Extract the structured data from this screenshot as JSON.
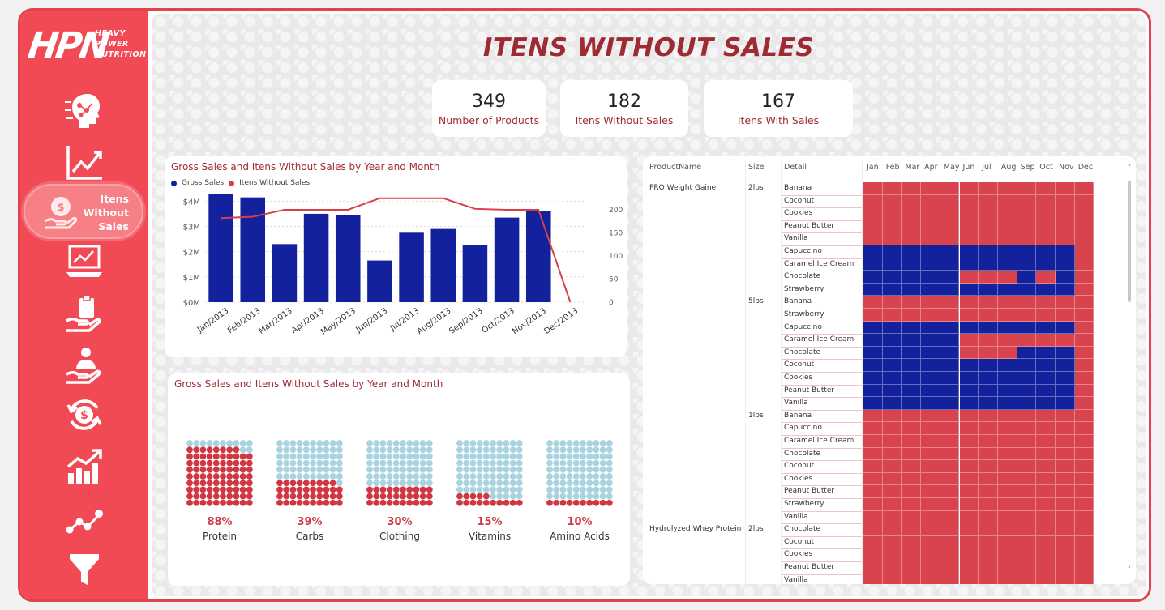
{
  "brand": {
    "logo_text": "HPN",
    "logo_sub": [
      "HEAVY",
      "POWER",
      "NUTRITION"
    ]
  },
  "sidebar": {
    "items": [
      {
        "icon": "ai-head-icon",
        "label": ""
      },
      {
        "icon": "trend-chart-icon",
        "label": ""
      },
      {
        "icon": "money-hand-icon",
        "label": "Itens\nWithout\nSales",
        "active": true
      },
      {
        "icon": "laptop-chart-icon",
        "label": ""
      },
      {
        "icon": "hand-clipboard-icon",
        "label": ""
      },
      {
        "icon": "hand-person-icon",
        "label": ""
      },
      {
        "icon": "dollar-cycle-icon",
        "label": ""
      },
      {
        "icon": "growth-bars-icon",
        "label": ""
      },
      {
        "icon": "line-points-icon",
        "label": ""
      },
      {
        "icon": "funnel-icon",
        "label": ""
      }
    ],
    "active_label_lines": [
      "Itens",
      "Without",
      "Sales"
    ]
  },
  "page": {
    "title": "ITENS WITHOUT SALES"
  },
  "kpis": [
    {
      "value": "349",
      "label": "Number of Products"
    },
    {
      "value": "182",
      "label": "Itens Without Sales"
    },
    {
      "value": "167",
      "label": "Itens With Sales"
    }
  ],
  "bar_card": {
    "title": "Gross Sales and Itens Without Sales by Year and Month",
    "legend": [
      "Gross Sales",
      "Itens Without Sales"
    ]
  },
  "waffle_card": {
    "title": "Gross Sales and Itens Without Sales by Year and Month"
  },
  "chart_data": [
    {
      "type": "bar",
      "title": "Gross Sales and Itens Without Sales by Year and Month",
      "categories": [
        "Jan/2013",
        "Feb/2013",
        "Mar/2013",
        "Apr/2013",
        "May/2013",
        "Jun/2013",
        "Jul/2013",
        "Aug/2013",
        "Sep/2013",
        "Oct/2013",
        "Nov/2013",
        "Dec/2013"
      ],
      "series": [
        {
          "name": "Gross Sales",
          "type": "bar",
          "axis": "left",
          "values": [
            4.3,
            4.15,
            2.3,
            3.5,
            3.45,
            1.65,
            2.75,
            2.9,
            2.25,
            3.35,
            3.6,
            0
          ]
        },
        {
          "name": "Itens Without Sales",
          "type": "line",
          "axis": "right",
          "values": [
            182,
            185,
            200,
            200,
            200,
            225,
            225,
            225,
            202,
            200,
            200,
            0
          ]
        }
      ],
      "y_left": {
        "ticks": [
          "$0M",
          "$1M",
          "$2M",
          "$3M",
          "$4M"
        ],
        "range": [
          0,
          4.3
        ]
      },
      "y_right": {
        "ticks": [
          "0",
          "50",
          "100",
          "150",
          "200"
        ],
        "range": [
          0,
          235
        ]
      },
      "colors": {
        "bars": "#13219d",
        "line": "#d6404b"
      }
    },
    {
      "type": "waffle",
      "title": "Gross Sales and Itens Without Sales by Year and Month",
      "categories": [
        "Protein",
        "Carbs",
        "Clothing",
        "Vitamins",
        "Amino Acids"
      ],
      "values": [
        88,
        39,
        30,
        15,
        10
      ],
      "labels": [
        "88%",
        "39%",
        "30%",
        "15%",
        "10%"
      ],
      "colors": {
        "filled": "#d13743",
        "empty": "#a8d3df"
      }
    }
  ],
  "matrix": {
    "headers": [
      "ProductName",
      "Size",
      "Detail"
    ],
    "months": [
      "Jan",
      "Feb",
      "Mar",
      "Apr",
      "May",
      "Jun",
      "Jul",
      "Aug",
      "Sep",
      "Oct",
      "Nov",
      "Dec"
    ],
    "colors": {
      "sales": "#13219d",
      "no_sales": "#d8434e"
    },
    "rows": [
      {
        "product": "PRO Weight Gainer",
        "size": "2lbs",
        "detail": "Banana",
        "sales": [
          0,
          0,
          0,
          0,
          0,
          0,
          0,
          0,
          0,
          0,
          0,
          0
        ]
      },
      {
        "product": "",
        "size": "",
        "detail": "Coconut",
        "sales": [
          0,
          0,
          0,
          0,
          0,
          0,
          0,
          0,
          0,
          0,
          0,
          0
        ]
      },
      {
        "product": "",
        "size": "",
        "detail": "Cookies",
        "sales": [
          0,
          0,
          0,
          0,
          0,
          0,
          0,
          0,
          0,
          0,
          0,
          0
        ]
      },
      {
        "product": "",
        "size": "",
        "detail": "Peanut Butter",
        "sales": [
          0,
          0,
          0,
          0,
          0,
          0,
          0,
          0,
          0,
          0,
          0,
          0
        ]
      },
      {
        "product": "",
        "size": "",
        "detail": "Vanilla",
        "sales": [
          0,
          0,
          0,
          0,
          0,
          0,
          0,
          0,
          0,
          0,
          0,
          0
        ]
      },
      {
        "product": "",
        "size": "",
        "detail": "Capuccino",
        "sales": [
          1,
          1,
          1,
          1,
          1,
          1,
          1,
          1,
          1,
          1,
          1,
          0
        ]
      },
      {
        "product": "",
        "size": "",
        "detail": "Caramel Ice Cream",
        "sales": [
          1,
          1,
          1,
          1,
          1,
          1,
          1,
          1,
          1,
          1,
          1,
          0
        ]
      },
      {
        "product": "",
        "size": "",
        "detail": "Chocolate",
        "sales": [
          1,
          1,
          1,
          1,
          1,
          0,
          0,
          0,
          1,
          0,
          1,
          0
        ]
      },
      {
        "product": "",
        "size": "",
        "detail": "Strawberry",
        "sales": [
          1,
          1,
          1,
          1,
          1,
          1,
          1,
          1,
          1,
          1,
          1,
          0
        ]
      },
      {
        "product": "",
        "size": "5lbs",
        "detail": "Banana",
        "sales": [
          0,
          0,
          0,
          0,
          0,
          0,
          0,
          0,
          0,
          0,
          0,
          0
        ]
      },
      {
        "product": "",
        "size": "",
        "detail": "Strawberry",
        "sales": [
          0,
          0,
          0,
          0,
          0,
          0,
          0,
          0,
          0,
          0,
          0,
          0
        ]
      },
      {
        "product": "",
        "size": "",
        "detail": "Capuccino",
        "sales": [
          1,
          1,
          1,
          1,
          1,
          1,
          1,
          1,
          1,
          1,
          1,
          0
        ]
      },
      {
        "product": "",
        "size": "",
        "detail": "Caramel Ice Cream",
        "sales": [
          1,
          1,
          1,
          1,
          1,
          0,
          0,
          0,
          0,
          0,
          0,
          0
        ]
      },
      {
        "product": "",
        "size": "",
        "detail": "Chocolate",
        "sales": [
          1,
          1,
          1,
          1,
          1,
          0,
          0,
          0,
          1,
          1,
          1,
          0
        ]
      },
      {
        "product": "",
        "size": "",
        "detail": "Coconut",
        "sales": [
          1,
          1,
          1,
          1,
          1,
          1,
          1,
          1,
          1,
          1,
          1,
          0
        ]
      },
      {
        "product": "",
        "size": "",
        "detail": "Cookies",
        "sales": [
          1,
          1,
          1,
          1,
          1,
          1,
          1,
          1,
          1,
          1,
          1,
          0
        ]
      },
      {
        "product": "",
        "size": "",
        "detail": "Peanut Butter",
        "sales": [
          1,
          1,
          1,
          1,
          1,
          1,
          1,
          1,
          1,
          1,
          1,
          0
        ]
      },
      {
        "product": "",
        "size": "",
        "detail": "Vanilla",
        "sales": [
          1,
          1,
          1,
          1,
          1,
          1,
          1,
          1,
          1,
          1,
          1,
          0
        ]
      },
      {
        "product": "",
        "size": "1lbs",
        "detail": "Banana",
        "sales": [
          0,
          0,
          0,
          0,
          0,
          0,
          0,
          0,
          0,
          0,
          0,
          0
        ]
      },
      {
        "product": "",
        "size": "",
        "detail": "Capuccino",
        "sales": [
          0,
          0,
          0,
          0,
          0,
          0,
          0,
          0,
          0,
          0,
          0,
          0
        ]
      },
      {
        "product": "",
        "size": "",
        "detail": "Caramel Ice Cream",
        "sales": [
          0,
          0,
          0,
          0,
          0,
          0,
          0,
          0,
          0,
          0,
          0,
          0
        ]
      },
      {
        "product": "",
        "size": "",
        "detail": "Chocolate",
        "sales": [
          0,
          0,
          0,
          0,
          0,
          0,
          0,
          0,
          0,
          0,
          0,
          0
        ]
      },
      {
        "product": "",
        "size": "",
        "detail": "Coconut",
        "sales": [
          0,
          0,
          0,
          0,
          0,
          0,
          0,
          0,
          0,
          0,
          0,
          0
        ]
      },
      {
        "product": "",
        "size": "",
        "detail": "Cookies",
        "sales": [
          0,
          0,
          0,
          0,
          0,
          0,
          0,
          0,
          0,
          0,
          0,
          0
        ]
      },
      {
        "product": "",
        "size": "",
        "detail": "Peanut Butter",
        "sales": [
          0,
          0,
          0,
          0,
          0,
          0,
          0,
          0,
          0,
          0,
          0,
          0
        ]
      },
      {
        "product": "",
        "size": "",
        "detail": "Strawberry",
        "sales": [
          0,
          0,
          0,
          0,
          0,
          0,
          0,
          0,
          0,
          0,
          0,
          0
        ]
      },
      {
        "product": "",
        "size": "",
        "detail": "Vanilla",
        "sales": [
          0,
          0,
          0,
          0,
          0,
          0,
          0,
          0,
          0,
          0,
          0,
          0
        ]
      },
      {
        "product": "Hydrolyzed Whey Protein",
        "size": "2lbs",
        "detail": "Chocolate",
        "sales": [
          0,
          0,
          0,
          0,
          0,
          0,
          0,
          0,
          0,
          0,
          0,
          0
        ]
      },
      {
        "product": "",
        "size": "",
        "detail": "Coconut",
        "sales": [
          0,
          0,
          0,
          0,
          0,
          0,
          0,
          0,
          0,
          0,
          0,
          0
        ]
      },
      {
        "product": "",
        "size": "",
        "detail": "Cookies",
        "sales": [
          0,
          0,
          0,
          0,
          0,
          0,
          0,
          0,
          0,
          0,
          0,
          0
        ]
      },
      {
        "product": "",
        "size": "",
        "detail": "Peanut Butter",
        "sales": [
          0,
          0,
          0,
          0,
          0,
          0,
          0,
          0,
          0,
          0,
          0,
          0
        ]
      },
      {
        "product": "",
        "size": "",
        "detail": "Vanilla",
        "sales": [
          0,
          0,
          0,
          0,
          0,
          0,
          0,
          0,
          0,
          0,
          0,
          0
        ]
      }
    ]
  },
  "scroll": {
    "up": "˄",
    "down": "˅"
  }
}
